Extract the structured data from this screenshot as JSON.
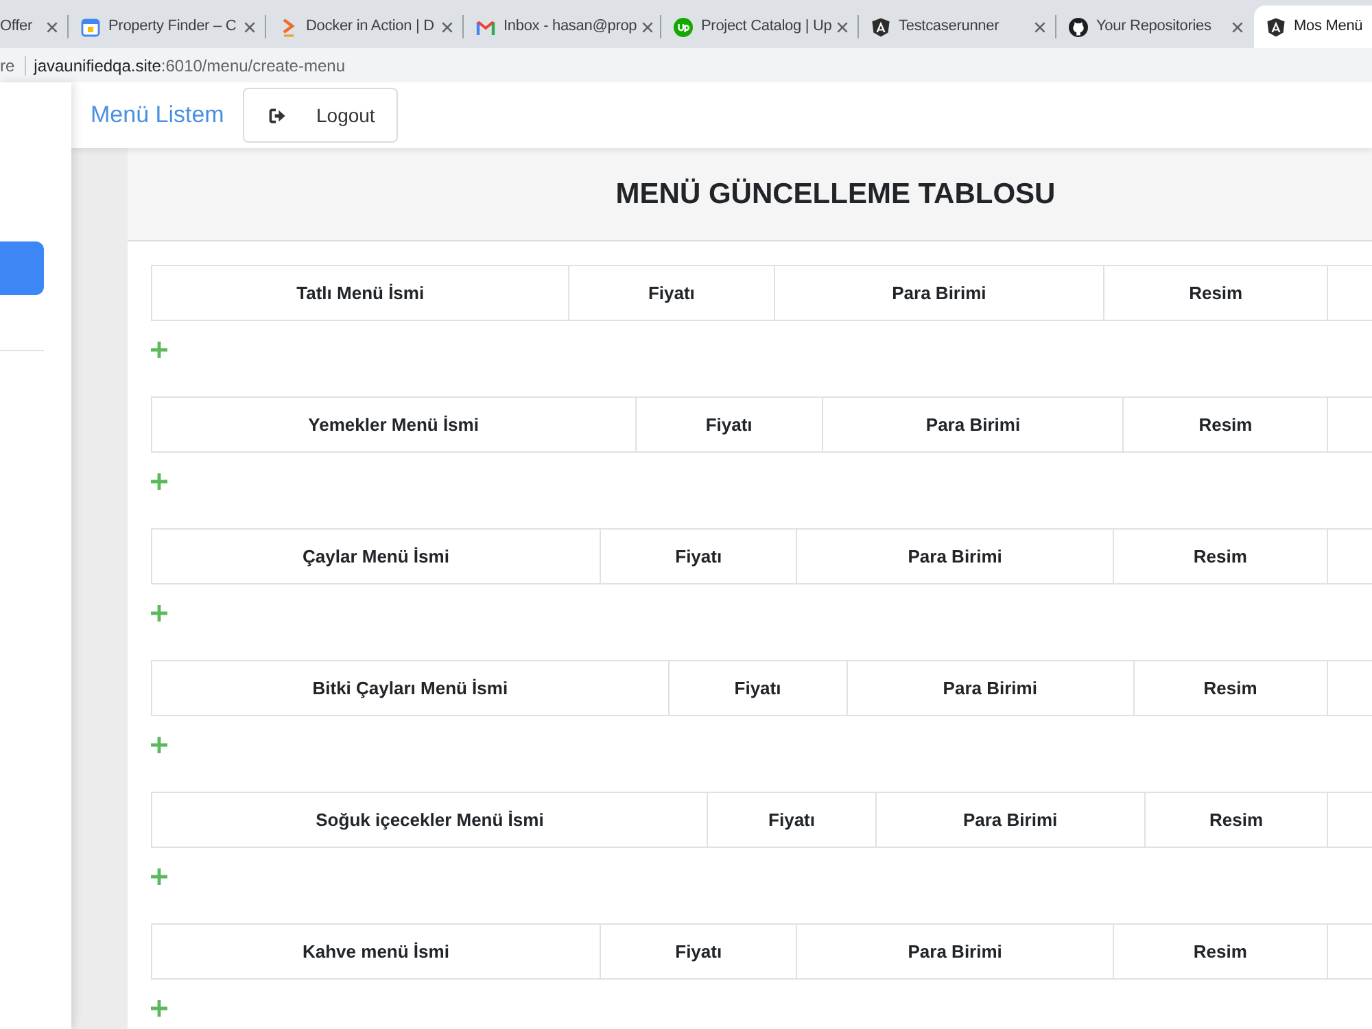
{
  "browser": {
    "tabs": [
      {
        "title": "Offer",
        "selected": false
      },
      {
        "title": "Property Finder – C",
        "kind": "calendar",
        "selected": false
      },
      {
        "title": "Docker in Action | D",
        "kind": "chevron",
        "selected": false
      },
      {
        "title": "Inbox - hasan@prop",
        "kind": "mail",
        "selected": false
      },
      {
        "title": "Project Catalog | Up",
        "kind": "round-badge",
        "selected": false
      },
      {
        "title": "Testcaserunner",
        "kind": "shield",
        "selected": false
      },
      {
        "title": "Your Repositories",
        "kind": "octo",
        "selected": false
      },
      {
        "title": "Mos Menü",
        "kind": "shield",
        "selected": true
      }
    ],
    "address_bar": {
      "security_text": "re",
      "host": "javaunifiedqa.site",
      "path": ":6010/menu/create-menu"
    }
  },
  "navbar": {
    "brand": "Menü Listem",
    "logout_button": "Logout"
  },
  "page_title": "MENÜ GÜNCELLEME TABLOSU",
  "menu_tables": [
    {
      "columns": [
        "Tatlı Menü İsmi",
        "Fiyatı",
        "Para Birimi",
        "Resim"
      ]
    },
    {
      "columns": [
        "Yemekler Menü İsmi",
        "Fiyatı",
        "Para Birimi",
        "Resim"
      ]
    },
    {
      "columns": [
        "Çaylar Menü İsmi",
        "Fiyatı",
        "Para Birimi",
        "Resim"
      ]
    },
    {
      "columns": [
        "Bitki Çayları Menü İsmi",
        "Fiyatı",
        "Para Birimi",
        "Resim"
      ]
    },
    {
      "columns": [
        "Soğuk içecekler Menü İsmi",
        "Fiyatı",
        "Para Birimi",
        "Resim"
      ]
    },
    {
      "columns": [
        "Kahve menü İsmi",
        "Fiyatı",
        "Para Birimi",
        "Resim"
      ]
    }
  ]
}
